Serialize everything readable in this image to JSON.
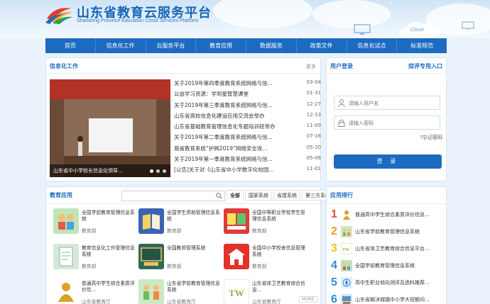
{
  "brand": {
    "title": "山东省教育云服务平台",
    "subtitle": "Shandong Province Education Cloud Services Platform",
    "cloud_badge": "Cloud"
  },
  "nav": [
    "首页",
    "信息化工作",
    "云服务平台",
    "教育应用",
    "数据服务",
    "政策文件",
    "信息化试点",
    "标准规范"
  ],
  "info_work": {
    "title": "信息化工作",
    "more": "更多",
    "slide_caption": "山东省中小学校长信息化领导...",
    "news": [
      {
        "title": "关于2019年第四季度教育系统网络与信...",
        "date": "03-04"
      },
      {
        "title": "公益学习资源：学到星智慧课堂",
        "date": "01-31"
      },
      {
        "title": "关于2019年第三季度教育系统网络与信...",
        "date": "12-27"
      },
      {
        "title": "山东省高校信息化建设应用交流会举办",
        "date": "12-13"
      },
      {
        "title": "山东省基础教育管理信息化专题培训班举办",
        "date": "11-09"
      },
      {
        "title": "关于2019年第二季度教育系统网络与信...",
        "date": "07-18"
      },
      {
        "title": "我省教育系统“护网2019”网络安全攻...",
        "date": "05-20"
      },
      {
        "title": "关于2019年第一季度教育系统网络与信...",
        "date": "05-06"
      },
      {
        "title": "[公告]关于对《山东省中小学数字化校园...",
        "date": "11-01"
      }
    ]
  },
  "login": {
    "title": "用户登录",
    "alt_link": "综评专用入口",
    "username_placeholder": "请输入用户名",
    "password_placeholder": "请输入密码",
    "forgot": "忘记密码",
    "button": "登 录"
  },
  "apps": {
    "title": "教育应用",
    "search_placeholder": "",
    "tabs": [
      "全部",
      "国家系统",
      "省建系统",
      "第三方系统"
    ],
    "more": "MORE",
    "items": [
      {
        "name": "全国学前教育管理信息系统",
        "owner": "教育部",
        "icon": "kids-icon"
      },
      {
        "name": "全国学生资助管理信息系统",
        "owner": "教育部",
        "icon": "book-icon"
      },
      {
        "name": "全国中等职业学校学生管理信息系统",
        "owner": "教育部",
        "icon": "cards-icon"
      },
      {
        "name": "教育信息化工作管理信息系统",
        "owner": "教育部",
        "icon": "document-icon"
      },
      {
        "name": "全国教师管理系统",
        "owner": "教育部",
        "icon": "blackboard-icon"
      },
      {
        "name": "全国中小学校舍信息管理系统",
        "owner": "教育部",
        "icon": "building-icon"
      },
      {
        "name": "普通高中学生综合素质评价信...",
        "owner": "山东省教育厅",
        "icon": "person-icon"
      },
      {
        "name": "山东省学前教育管理信息系统",
        "owner": "山东省教育厅",
        "icon": "children-icon"
      },
      {
        "name": "山东省体卫艺教育综合信息...",
        "owner": "山东省教育厅",
        "icon": "tw-icon"
      }
    ]
  },
  "ranking": {
    "title": "应用排行",
    "items": [
      {
        "num": "1",
        "name": "普通高中学生综合素质评价信息...",
        "color": "#e64b3c"
      },
      {
        "num": "2",
        "name": "山东省学前教育管理信息系统",
        "color": "#f0a020"
      },
      {
        "num": "3",
        "name": "山东省体卫艺教育综合信息平台...",
        "color": "#f0c020"
      },
      {
        "num": "4",
        "name": "全国学前教育管理信息系统",
        "color": "#2e8ad8"
      },
      {
        "num": "5",
        "name": "高中生职业倾向测评及选科推荐...",
        "color": "#2e8ad8"
      },
      {
        "num": "6",
        "name": "山东省解决城镇中小学大班额问...",
        "color": "#2e8ad8"
      }
    ]
  },
  "colors": {
    "primary": "#1c6bc0",
    "header_bg": "#cfe4f6"
  }
}
